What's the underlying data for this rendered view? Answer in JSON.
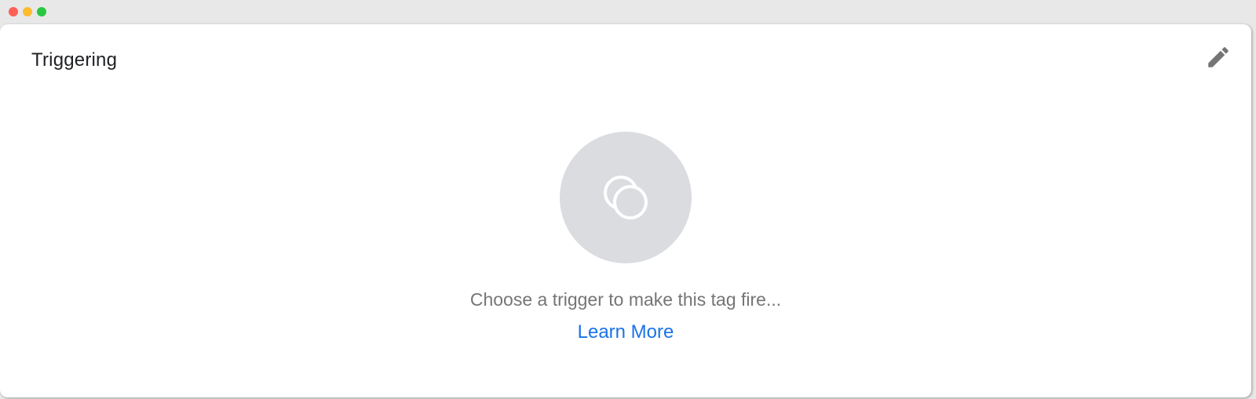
{
  "window": {
    "controls": [
      "close",
      "minimize",
      "maximize"
    ],
    "colors": {
      "close": "#fe5f57",
      "minimize": "#febc2e",
      "maximize": "#28c840"
    }
  },
  "card": {
    "title": "Triggering",
    "edit_icon": "pencil-icon",
    "empty_state": {
      "icon": "trigger-icon",
      "message": "Choose a trigger to make this tag fire...",
      "link_label": "Learn More"
    }
  },
  "colors": {
    "accent": "#1a73e8",
    "muted_text": "#757575",
    "icon_gray": "#757575",
    "circle_fill": "#dadce0"
  }
}
